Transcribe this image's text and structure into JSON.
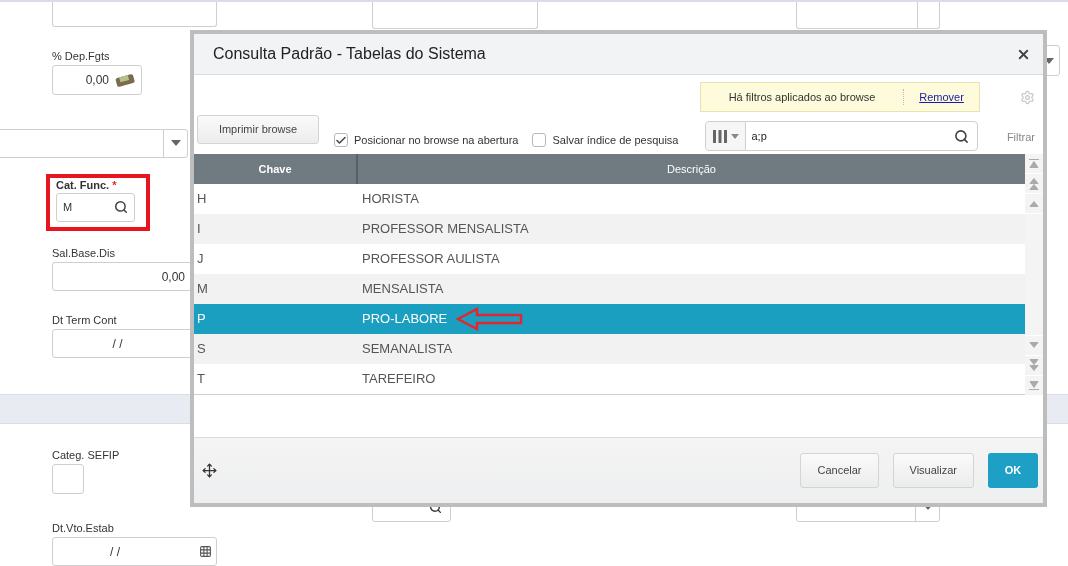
{
  "form": {
    "dep_fgts": {
      "label": "% Dep.Fgts",
      "value": "0,00"
    },
    "cat_func": {
      "label": "Cat. Func.",
      "required_mark": "*",
      "value": "M",
      "highlighted": true
    },
    "sal_base_dis": {
      "label": "Sal.Base.Dis",
      "value": "0,00"
    },
    "dt_term_cont": {
      "label": "Dt Term Cont",
      "value": "/ /"
    },
    "categ_sefip": {
      "label": "Categ. SEFIP"
    },
    "dt_vto_estab": {
      "label": "Dt.Vto.Estab",
      "value": "/ /"
    }
  },
  "dialog": {
    "title": "Consulta Padrão - Tabelas do Sistema",
    "filter_notice": {
      "text": "Há filtros aplicados ao browse",
      "link": "Remover"
    },
    "print_button": "Imprimir browse",
    "checkboxes": [
      {
        "label": "Posicionar no browse na abertura",
        "checked": true
      },
      {
        "label": "Salvar índice de pesquisa",
        "checked": false
      }
    ],
    "search": {
      "value": "a;p"
    },
    "filter_button": "Filtrar",
    "table": {
      "columns": [
        "Chave",
        "Descrição"
      ],
      "rows": [
        {
          "key": "H",
          "description": "HORISTA",
          "selected": false
        },
        {
          "key": "I",
          "description": "PROFESSOR MENSALISTA",
          "selected": false
        },
        {
          "key": "J",
          "description": "PROFESSOR AULISTA",
          "selected": false
        },
        {
          "key": "M",
          "description": "MENSALISTA",
          "selected": false
        },
        {
          "key": "P",
          "description": "PRO-LABORE",
          "selected": true
        },
        {
          "key": "S",
          "description": "SEMANALISTA",
          "selected": false
        },
        {
          "key": "T",
          "description": "TAREFEIRO",
          "selected": false
        }
      ]
    },
    "buttons": [
      {
        "label": "Cancelar",
        "kind": "secondary"
      },
      {
        "label": "Visualizar",
        "kind": "secondary"
      },
      {
        "label": "OK",
        "kind": "primary"
      }
    ]
  }
}
